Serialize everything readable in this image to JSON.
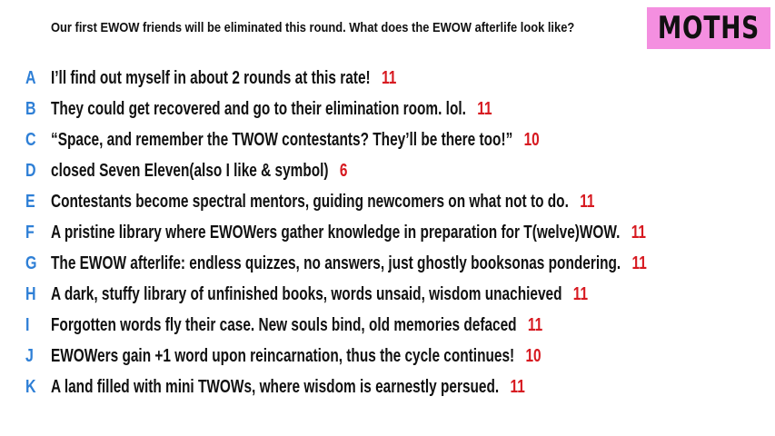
{
  "prompt": "Our first EWOW friends will be eliminated this round. What does the EWOW afterlife look like?",
  "badge": "MOTHS",
  "colors": {
    "letter": "#2e7fd6",
    "count": "#d71920",
    "badge_bg": "#f48fe0"
  },
  "responses": [
    {
      "letter": "A",
      "text": "I’ll find out myself in about 2 rounds at this rate!",
      "count": "11"
    },
    {
      "letter": "B",
      "text": "They could get recovered and go to their elimination room. lol.",
      "count": "11"
    },
    {
      "letter": "C",
      "text": "“Space, and remember the TWOW contestants? They’ll be there too!”",
      "count": "10"
    },
    {
      "letter": "D",
      "text": "closed Seven Eleven(also I like & symbol)",
      "count": "6"
    },
    {
      "letter": "E",
      "text": "Contestants become spectral mentors, guiding newcomers on what not to do.",
      "count": "11"
    },
    {
      "letter": "F",
      "text": "A pristine library where EWOWers gather knowledge in preparation for T(welve)WOW.",
      "count": "11"
    },
    {
      "letter": "G",
      "text": "The EWOW afterlife: endless quizzes, no answers, just ghostly booksonas pondering.",
      "count": "11"
    },
    {
      "letter": "H",
      "text": "A dark, stuffy library of unfinished books, words unsaid, wisdom unachieved",
      "count": "11"
    },
    {
      "letter": "I",
      "text": "Forgotten words fly their case. New souls bind, old memories defaced",
      "count": "11"
    },
    {
      "letter": "J",
      "text": "EWOWers gain +1 word upon reincarnation, thus the cycle continues!",
      "count": "10"
    },
    {
      "letter": "K",
      "text": "A land filled with mini TWOWs, where wisdom is earnestly persued.",
      "count": "11"
    }
  ]
}
